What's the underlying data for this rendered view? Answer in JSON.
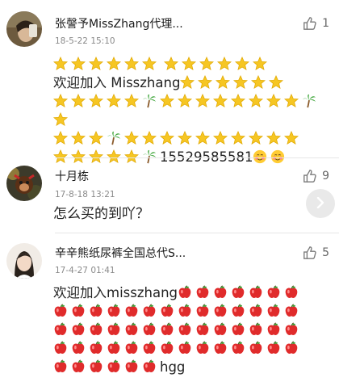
{
  "comments": [
    {
      "user": "张謦予MissZhang代理...",
      "time": "18-5-22 15:10",
      "likes": "1",
      "avatar_icon": "user-photo",
      "text_parts": [
        "欢迎加入 Misszhang",
        "15529585581"
      ],
      "emoji_sequence": "row1: 6 star, space, 6 star | line2 after text: 6 star | row3: 5 star, palm, 8 star, palm, 1 star | row4: 3 star, palm, 10 star | row5: 5 star, palm, phone, smile-blush, smile-blush"
    },
    {
      "user": "十月栋",
      "time": "17-8-18 13:21",
      "likes": "9",
      "avatar_icon": "monkey-photo",
      "text": "怎么买的到吖？"
    },
    {
      "user": "辛辛熊纸尿裤全国总代S...",
      "time": "17-4-27 01:41",
      "likes": "5",
      "avatar_icon": "woman-photo",
      "text_parts": [
        "欢迎加入misszhang",
        "hgg"
      ]
    }
  ],
  "scroll_button_icon": "chevron-right-icon"
}
